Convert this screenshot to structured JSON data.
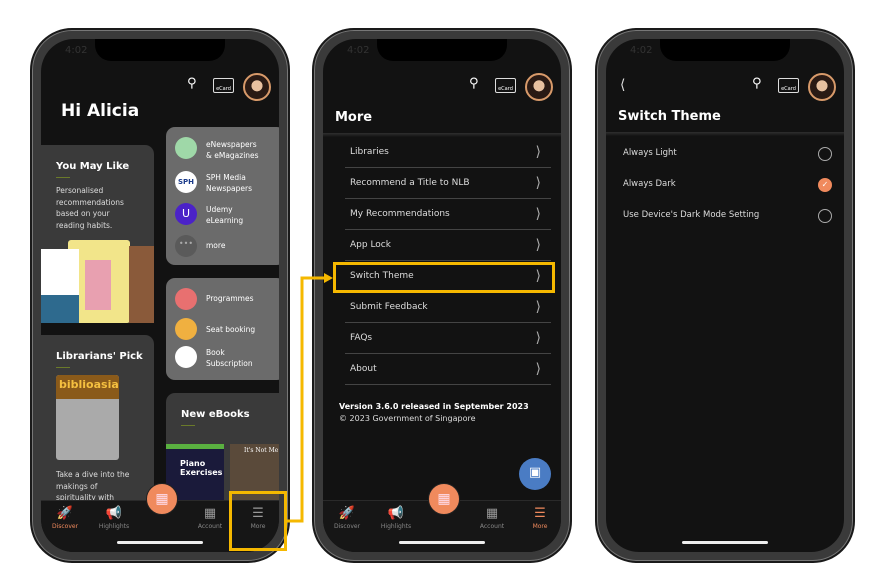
{
  "status_time": "4:02",
  "ecard_label": "eCard",
  "nav": {
    "discover": "Discover",
    "highlights": "Highlights",
    "account": "Account",
    "more": "More"
  },
  "colors": {
    "accent": "#f08a5d",
    "highlight": "#f5b800",
    "chat": "#4a7cc4"
  },
  "discover": {
    "greeting": "Hi Alicia",
    "you_may_like": {
      "title": "You May Like",
      "desc": [
        "Personalised",
        "recommendations",
        "based on your",
        "reading habits."
      ]
    },
    "services": [
      {
        "label": [
          "eNewspapers",
          "& eMagazines"
        ]
      },
      {
        "label": [
          "SPH Media",
          "Newspapers"
        ]
      },
      {
        "label": [
          "Udemy",
          "eLearning"
        ]
      },
      {
        "label": [
          "more"
        ]
      }
    ],
    "services2": [
      {
        "label": [
          "Programmes"
        ]
      },
      {
        "label": [
          "Seat booking"
        ]
      },
      {
        "label": [
          "Book",
          "Subscription"
        ]
      }
    ],
    "librarians_pick": {
      "title": "Librarians' Pick",
      "book": "biblioasia",
      "desc": [
        "Take a dive into the",
        "makings of",
        "spirituality with"
      ]
    },
    "new_ebooks": {
      "title": "New eBooks",
      "books": [
        "Piano Exercises",
        "It's Not Me"
      ]
    }
  },
  "more": {
    "title": "More",
    "items": [
      "Libraries",
      "Recommend a Title to NLB",
      "My Recommendations",
      "App Lock",
      "Switch Theme",
      "Submit Feedback",
      "FAQs",
      "About"
    ],
    "version": "Version 3.6.0 released in September 2023",
    "copyright": "© 2023 Government of Singapore"
  },
  "theme": {
    "title": "Switch Theme",
    "options": [
      {
        "label": "Always Light",
        "selected": false
      },
      {
        "label": "Always Dark",
        "selected": true
      },
      {
        "label": "Use Device's Dark Mode Setting",
        "selected": false
      }
    ]
  }
}
